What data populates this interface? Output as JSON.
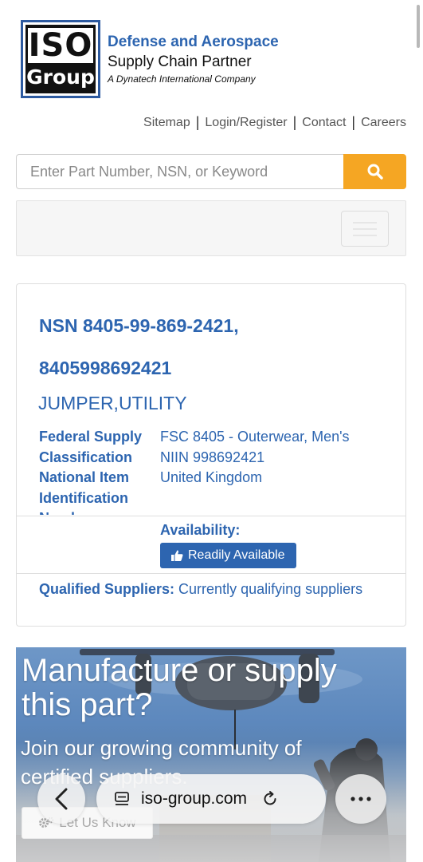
{
  "header": {
    "logo_top": "ISO",
    "logo_bottom": "Group",
    "brand_line1": "Defense and Aerospace",
    "brand_line2": "Supply Chain Partner",
    "brand_line3": "A Dynatech International Company"
  },
  "top_links": {
    "sitemap": "Sitemap",
    "login": "Login/Register",
    "contact": "Contact",
    "careers": "Careers",
    "separator": "|"
  },
  "search": {
    "placeholder": "Enter Part Number, NSN, or Keyword"
  },
  "part": {
    "nsn_line1": "NSN 8405-99-869-2421,",
    "nsn_line2": "8405998692421",
    "item_name": "JUMPER,UTILITY",
    "spec_labels": {
      "fsc_1": "Federal Supply",
      "fsc_2": "Classification",
      "niin_1": "National Item",
      "niin_2": "Identification",
      "niin_3": "Number"
    },
    "spec_values": {
      "fsc": "FSC 8405 - Outerwear, Men's",
      "niin": "NIIN 998692421",
      "country": "United Kingdom"
    },
    "availability_label": "Availability:",
    "availability_button": "Readily Available",
    "suppliers_label": "Qualified Suppliers:",
    "suppliers_value": "Currently qualifying suppliers"
  },
  "banner": {
    "headline": "Manufacture or supply this part?",
    "subtext": "Join our growing community of certified suppliers.",
    "button": "Let Us Know"
  },
  "browser": {
    "url": "iso-group.com"
  },
  "colors": {
    "brand_blue": "#2d65b0",
    "search_orange": "#f5a623"
  }
}
